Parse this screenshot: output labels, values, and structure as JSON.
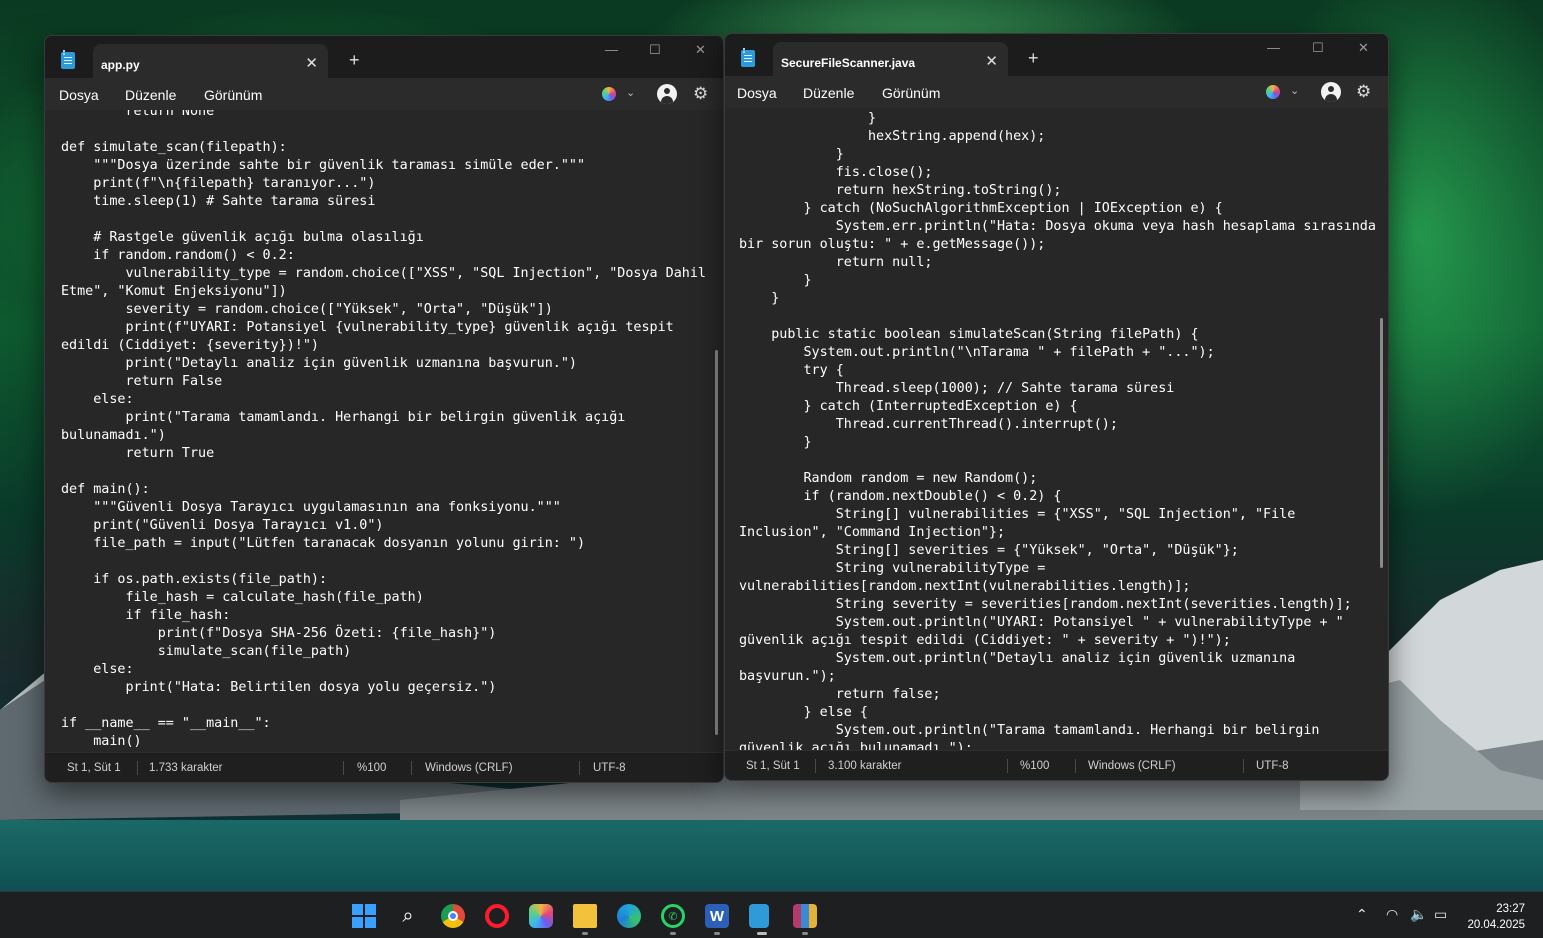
{
  "desktop": {
    "wallpaper": "aurora-over-snowy-mountains-and-fjord"
  },
  "windows": [
    {
      "id": "left",
      "tab_title": "app.py",
      "menu": [
        "Dosya",
        "Düzenle",
        "Görünüm"
      ],
      "code": "        return None\n\ndef simulate_scan(filepath):\n    \"\"\"Dosya üzerinde sahte bir güvenlik taraması simüle eder.\"\"\"\n    print(f\"\\n{filepath} taranıyor...\")\n    time.sleep(1) # Sahte tarama süresi\n\n    # Rastgele güvenlik açığı bulma olasılığı\n    if random.random() < 0.2:\n        vulnerability_type = random.choice([\"XSS\", \"SQL Injection\", \"Dosya Dahil\nEtme\", \"Komut Enjeksiyonu\"])\n        severity = random.choice([\"Yüksek\", \"Orta\", \"Düşük\"])\n        print(f\"UYARI: Potansiyel {vulnerability_type} güvenlik açığı tespit\nedildi (Ciddiyet: {severity})!\")\n        print(\"Detaylı analiz için güvenlik uzmanına başvurun.\")\n        return False\n    else:\n        print(\"Tarama tamamlandı. Herhangi bir belirgin güvenlik açığı\nbulunamadı.\")\n        return True\n\ndef main():\n    \"\"\"Güvenli Dosya Tarayıcı uygulamasının ana fonksiyonu.\"\"\"\n    print(\"Güvenli Dosya Tarayıcı v1.0\")\n    file_path = input(\"Lütfen taranacak dosyanın yolunu girin: \")\n\n    if os.path.exists(file_path):\n        file_hash = calculate_hash(file_path)\n        if file_hash:\n            print(f\"Dosya SHA-256 Özeti: {file_hash}\")\n            simulate_scan(file_path)\n    else:\n        print(\"Hata: Belirtilen dosya yolu geçersiz.\")\n\nif __name__ == \"__main__\":\n    main()",
      "status": {
        "position": "St 1, Süt 1",
        "chars": "1.733 karakter",
        "zoom": "%100",
        "line_ending": "Windows (CRLF)",
        "encoding": "UTF-8"
      }
    },
    {
      "id": "right",
      "tab_title": "SecureFileScanner.java",
      "menu": [
        "Dosya",
        "Düzenle",
        "Görünüm"
      ],
      "code": "                }\n                hexString.append(hex);\n            }\n            fis.close();\n            return hexString.toString();\n        } catch (NoSuchAlgorithmException | IOException e) {\n            System.err.println(\"Hata: Dosya okuma veya hash hesaplama sırasında\nbir sorun oluştu: \" + e.getMessage());\n            return null;\n        }\n    }\n\n    public static boolean simulateScan(String filePath) {\n        System.out.println(\"\\nTarama \" + filePath + \"...\");\n        try {\n            Thread.sleep(1000); // Sahte tarama süresi\n        } catch (InterruptedException e) {\n            Thread.currentThread().interrupt();\n        }\n\n        Random random = new Random();\n        if (random.nextDouble() < 0.2) {\n            String[] vulnerabilities = {\"XSS\", \"SQL Injection\", \"File\nInclusion\", \"Command Injection\"};\n            String[] severities = {\"Yüksek\", \"Orta\", \"Düşük\"};\n            String vulnerabilityType =\nvulnerabilities[random.nextInt(vulnerabilities.length)];\n            String severity = severities[random.nextInt(severities.length)];\n            System.out.println(\"UYARI: Potansiyel \" + vulnerabilityType + \"\ngüvenlik açığı tespit edildi (Ciddiyet: \" + severity + \")!\");\n            System.out.println(\"Detaylı analiz için güvenlik uzmanına\nbaşvurun.\");\n            return false;\n        } else {\n            System.out.println(\"Tarama tamamlandı. Herhangi bir belirgin\ngüvenlik açığı bulunamadı.\");",
      "status": {
        "position": "St 1, Süt 1",
        "chars": "3.100 karakter",
        "zoom": "%100",
        "line_ending": "Windows (CRLF)",
        "encoding": "UTF-8"
      }
    }
  ],
  "icons": {
    "tab_close": "✕",
    "tab_add": "+",
    "minimize": "—",
    "maximize": "☐",
    "close": "✕",
    "chevron": "⌄",
    "gear": "⚙"
  },
  "taskbar": {
    "apps": [
      {
        "name": "start-icon",
        "color": "#3aa0ff"
      },
      {
        "name": "search-icon",
        "color": "#ffffff"
      },
      {
        "name": "chrome-icon",
        "color": "#e04a3a"
      },
      {
        "name": "opera-icon",
        "color": "#ff1b2d"
      },
      {
        "name": "copilot-icon",
        "color": "#6a5cf0"
      },
      {
        "name": "file-explorer-icon",
        "color": "#f3c23c"
      },
      {
        "name": "edge-icon",
        "color": "#1fa5d8"
      },
      {
        "name": "whatsapp-icon",
        "color": "#25d366"
      },
      {
        "name": "word-icon",
        "color": "#2b5fb8"
      },
      {
        "name": "notepad-icon",
        "color": "#2f9ad8"
      },
      {
        "name": "winrar-icon",
        "color": "#b33a6a"
      }
    ],
    "time": "23:27",
    "date": "20.04.2025"
  }
}
